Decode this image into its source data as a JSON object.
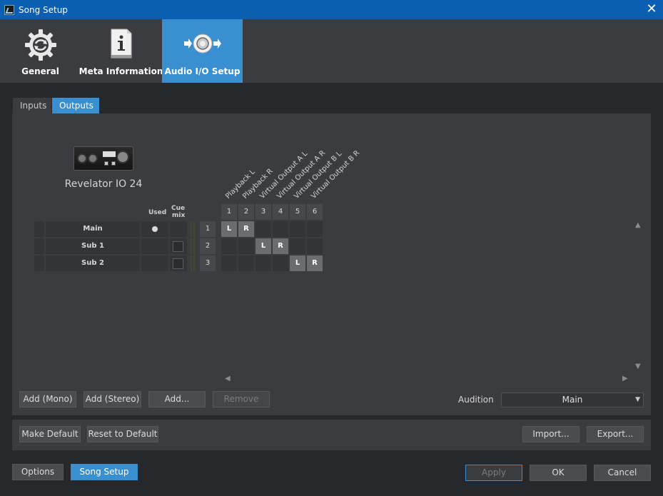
{
  "window": {
    "title": "Song Setup",
    "close_glyph": "✕"
  },
  "top_tabs": [
    {
      "label": "General",
      "icon": "gear-sync-icon"
    },
    {
      "label": "Meta Information",
      "icon": "info-document-icon"
    },
    {
      "label": "Audio I/O Setup",
      "icon": "speaker-io-icon",
      "active": true
    }
  ],
  "sub_tabs": {
    "inputs": "Inputs",
    "outputs": "Outputs"
  },
  "device": {
    "name": "Revelator IO 24"
  },
  "matrix": {
    "used_header": "Used",
    "cue_header_1": "Cue",
    "cue_header_2": "mix",
    "channel_labels": [
      "Playback L",
      "Playback R",
      "Virtual Output A L",
      "Virtual Output A R",
      "Virtual Output B L",
      "Virtual Output B R"
    ],
    "channel_numbers": [
      "1",
      "2",
      "3",
      "4",
      "5",
      "6"
    ],
    "rows": [
      {
        "name": "Main",
        "bus": "1",
        "used": true,
        "l": "L",
        "r": "R"
      },
      {
        "name": "Sub 1",
        "bus": "2",
        "used": false,
        "l": "L",
        "r": "R"
      },
      {
        "name": "Sub 2",
        "bus": "3",
        "used": false,
        "l": "L",
        "r": "R"
      }
    ]
  },
  "buttons": {
    "add_mono": "Add (Mono)",
    "add_stereo": "Add (Stereo)",
    "add": "Add...",
    "remove": "Remove",
    "make_default": "Make Default",
    "reset_default": "Reset to Default",
    "import": "Import...",
    "export": "Export...",
    "options": "Options",
    "song_setup": "Song Setup",
    "apply": "Apply",
    "ok": "OK",
    "cancel": "Cancel"
  },
  "audition": {
    "label": "Audition",
    "value": "Main"
  },
  "colors": {
    "titlebar": "#0b5fb3",
    "accent": "#3a8fd0",
    "panel": "#3a3c40"
  }
}
